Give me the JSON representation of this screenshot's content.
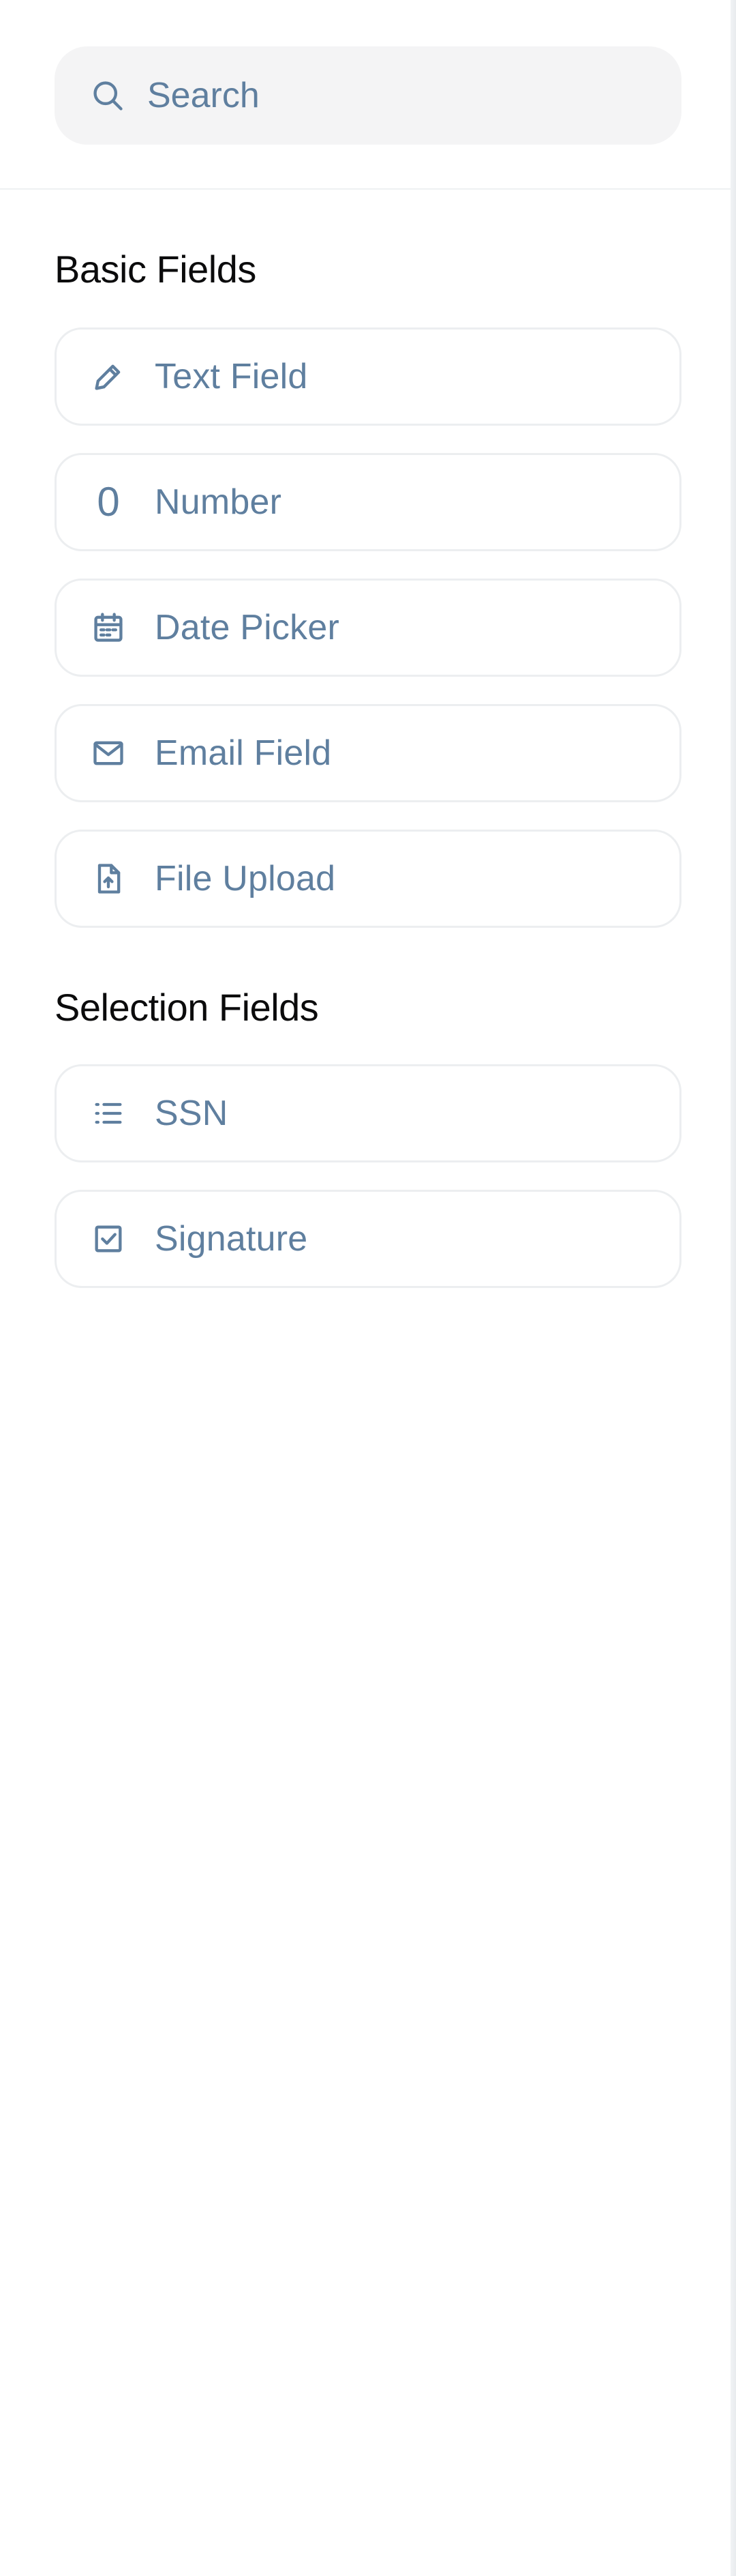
{
  "search": {
    "placeholder": "Search",
    "icon": "search-icon"
  },
  "colors": {
    "accent_text": "#5f7f9f",
    "heading_text": "#0b0b0c",
    "card_border": "#eceef0",
    "search_bg": "#f4f4f5"
  },
  "sections": [
    {
      "title": "Basic Fields",
      "items": [
        {
          "label": "Text Field",
          "icon": "pencil-icon"
        },
        {
          "label": "Number",
          "icon": "number-icon",
          "glyph": "0"
        },
        {
          "label": "Date Picker",
          "icon": "calendar-icon"
        },
        {
          "label": "Email Field",
          "icon": "envelope-icon"
        },
        {
          "label": "File Upload",
          "icon": "file-upload-icon"
        }
      ]
    },
    {
      "title": "Selection Fields",
      "items": [
        {
          "label": "SSN",
          "icon": "list-icon"
        },
        {
          "label": "Signature",
          "icon": "checkbox-icon"
        }
      ]
    }
  ]
}
